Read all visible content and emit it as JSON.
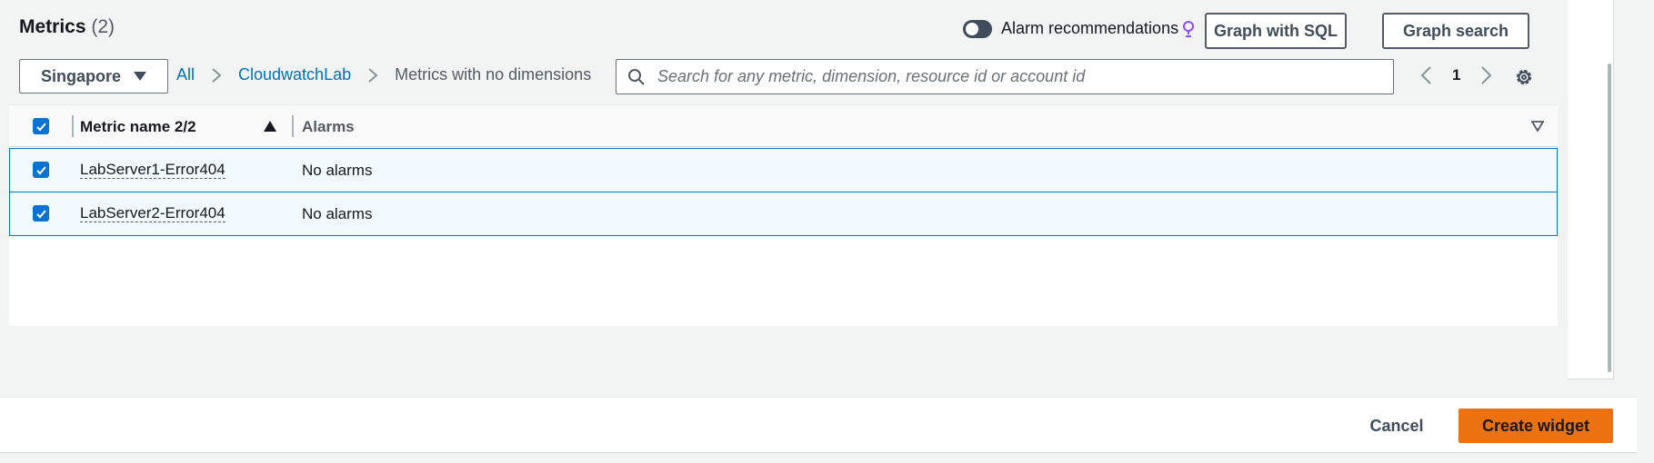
{
  "header": {
    "title": "Metrics",
    "count": "(2)",
    "alarm_recommendations_label": "Alarm recommendations",
    "alarm_recommendations_on": false,
    "graph_with_sql_label": "Graph with SQL",
    "graph_search_label": "Graph search"
  },
  "toolbar": {
    "region": "Singapore",
    "breadcrumb": [
      "All",
      "CloudwatchLab",
      "Metrics with no dimensions"
    ],
    "search_placeholder": "Search for any metric, dimension, resource id or account id",
    "search_value": "",
    "page_number": "1"
  },
  "table": {
    "columns": [
      "Metric name 2/2",
      "Alarms"
    ],
    "sort_direction": "ascending",
    "all_selected": true,
    "rows": [
      {
        "metric_name": "LabServer1-Error404",
        "alarms": "No alarms",
        "selected": true
      },
      {
        "metric_name": "LabServer2-Error404",
        "alarms": "No alarms",
        "selected": true
      }
    ]
  },
  "footer": {
    "cancel_label": "Cancel",
    "create_label": "Create widget"
  },
  "colors": {
    "accent": "#0972d3",
    "primary_button": "#ec7211",
    "link": "#0073bb",
    "bulb": "#8c4fff"
  },
  "icons": {
    "bulb": "lightbulb-icon",
    "caret": "caret-down-icon",
    "search": "search-icon",
    "settings": "gear-icon",
    "sort": "sort-ascending-icon",
    "column_prefs": "triangle-down-icon"
  }
}
